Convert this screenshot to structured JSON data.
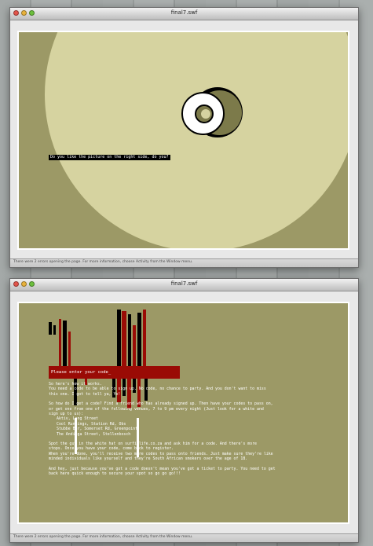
{
  "colors": {
    "stage_background": "#9c9966",
    "circle": "#d6d3a0",
    "prompt_bar": "#9a0b05",
    "text": "#ffffff"
  },
  "window_top": {
    "title": "final7.swf",
    "caption": "Do you like the picture on the right side, do you?",
    "status": "There were 2 errors opening the page. For more information, choose Activity from the Window menu."
  },
  "window_bottom": {
    "title": "final7.swf",
    "prompt": "Please enter your code_",
    "paragraphs": [
      {
        "lines": [
          "So here's how it works.",
          "You need a code to be able to sign up. No code, no chance to party. And you don't want to miss",
          "this one. I got to tell ya, Yo!"
        ]
      },
      {
        "lines": [
          "So how do I get a code? Find a friend who has already signed up. Then have your codes to pass on,",
          "or get one from one of the following venues, 7 to 9 pm every night (Just look for a white and",
          "sign up to us):"
        ],
        "items": [
          "Aktiv, Long Street",
          "Cool Runnings, Station Rd, Obs",
          "Stubbe Bar, Somerset Rd, Greenpoint",
          "The Andinga Street, Stellenbosch"
        ]
      },
      {
        "lines": [
          "Spot the guy in the white hat on surfinlife.co.za and ask him for a code. And there's more",
          "stops. Once you have your code, come back to register.",
          "When you're done, you'll receive two more codes to pass onto friends. Just make sure they're like",
          "minded individuals like yourself and they're South African smokers over the age of 18."
        ]
      },
      {
        "lines": [
          "And hey, just because you've got a code doesn't mean you've got a ticket to party. You need to get",
          "back here quick enough to secure your spot so go go go!!!"
        ]
      }
    ],
    "status": "There were 2 errors opening the page. For more information, choose Activity from the Window menu."
  }
}
